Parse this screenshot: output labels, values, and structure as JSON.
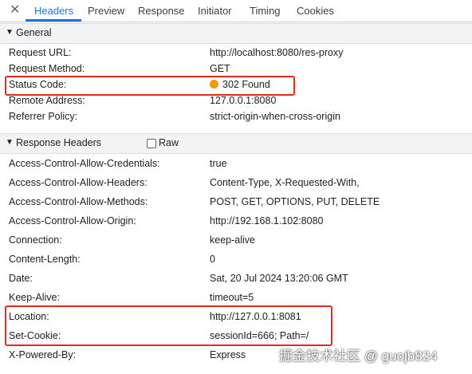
{
  "tabs": {
    "close_glyph": "✕",
    "items": [
      "Headers",
      "Preview",
      "Response",
      "Initiator",
      "Timing",
      "Cookies"
    ],
    "active": "Headers"
  },
  "general": {
    "title": "General",
    "rows": [
      {
        "key": "Request URL:",
        "value": "http://localhost:8080/res-proxy"
      },
      {
        "key": "Request Method:",
        "value": "GET"
      },
      {
        "key": "Status Code:",
        "value": "302 Found",
        "status_color": "#f29900"
      },
      {
        "key": "Remote Address:",
        "value": "127.0.0.1:8080"
      },
      {
        "key": "Referrer Policy:",
        "value": "strict-origin-when-cross-origin"
      }
    ]
  },
  "response_headers": {
    "title": "Response Headers",
    "raw_label": "Raw",
    "rows": [
      {
        "key": "Access-Control-Allow-Credentials:",
        "value": "true"
      },
      {
        "key": "Access-Control-Allow-Headers:",
        "value": "Content-Type, X-Requested-With,"
      },
      {
        "key": "Access-Control-Allow-Methods:",
        "value": "POST, GET, OPTIONS, PUT, DELETE"
      },
      {
        "key": "Access-Control-Allow-Origin:",
        "value": "http://192.168.1.102:8080"
      },
      {
        "key": "Connection:",
        "value": "keep-alive"
      },
      {
        "key": "Content-Length:",
        "value": "0"
      },
      {
        "key": "Date:",
        "value": "Sat, 20 Jul 2024 13:20:06 GMT"
      },
      {
        "key": "Keep-Alive:",
        "value": "timeout=5"
      },
      {
        "key": "Location:",
        "value": "http://127.0.0.1:8081"
      },
      {
        "key": "Set-Cookie:",
        "value": "sessionId=666; Path=/"
      },
      {
        "key": "X-Powered-By:",
        "value": "Express"
      }
    ]
  },
  "watermark": "掘金技术社区 @ guojb824",
  "colors": {
    "accent": "#1a73e8",
    "highlight": "#e02b20"
  }
}
